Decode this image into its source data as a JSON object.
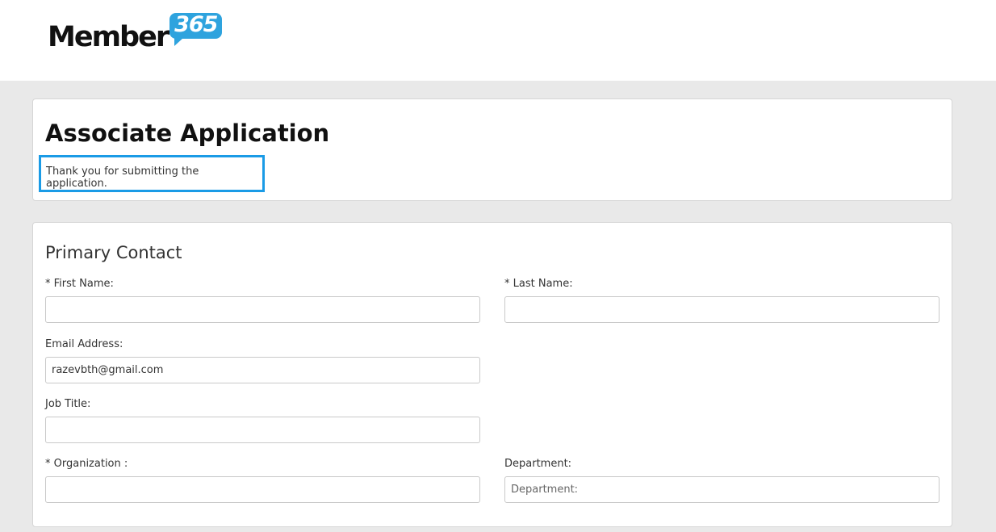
{
  "header": {
    "logo_word": "Member",
    "logo_badge": "365"
  },
  "application": {
    "title": "Associate Application",
    "confirmation": "Thank you for submitting the application."
  },
  "primary_contact": {
    "section_title": "Primary Contact",
    "first_name": {
      "label": "* First Name:",
      "value": ""
    },
    "last_name": {
      "label": "* Last Name:",
      "value": ""
    },
    "email": {
      "label": "Email Address:",
      "value": "razevbth@gmail.com"
    },
    "job_title": {
      "label": "Job Title:",
      "value": ""
    },
    "organization": {
      "label": "* Organization :",
      "value": ""
    },
    "department": {
      "label": "Department:",
      "value": "",
      "placeholder": "Department:"
    }
  },
  "colors": {
    "brand_blue": "#2ea3de",
    "highlight_border": "#1a9be6",
    "page_background": "#e9e9e9"
  }
}
